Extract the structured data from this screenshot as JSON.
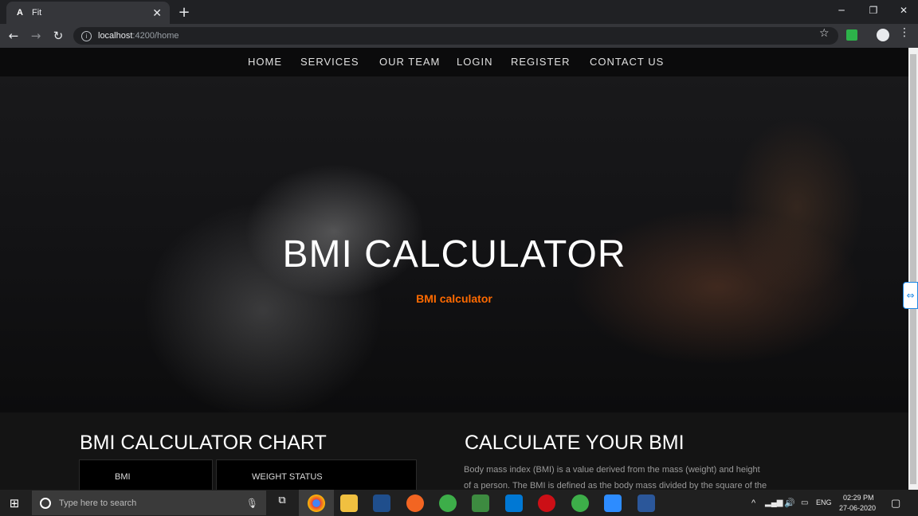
{
  "browser": {
    "tab_title": "Fit",
    "tab_icon": "A",
    "url_host": "localhost",
    "url_path": ":4200/home"
  },
  "nav": {
    "items": [
      "HOME",
      "SERVICES",
      "OUR TEAM",
      "LOGIN",
      "REGISTER",
      "CONTACT US"
    ]
  },
  "hero": {
    "title": "BMI CALCULATOR",
    "subtitle": "BMI calculator"
  },
  "chart_section": {
    "title": "BMI CALCULATOR CHART",
    "columns": [
      "BMI",
      "WEIGHT STATUS"
    ]
  },
  "calc_section": {
    "title": "CALCULATE YOUR BMI",
    "line1": "Body mass index (BMI) is a value derived from the mass (weight) and height",
    "line2": "of a person. The BMI is defined as the body mass divided by the square of the"
  },
  "taskbar": {
    "search_placeholder": "Type here to search",
    "lang": "ENG",
    "time": "02:29 PM",
    "date": "27-06-2020"
  },
  "colors": {
    "accent": "#ff6a00",
    "chrome_dark": "#202124",
    "chrome_toolbar": "#35363a"
  }
}
